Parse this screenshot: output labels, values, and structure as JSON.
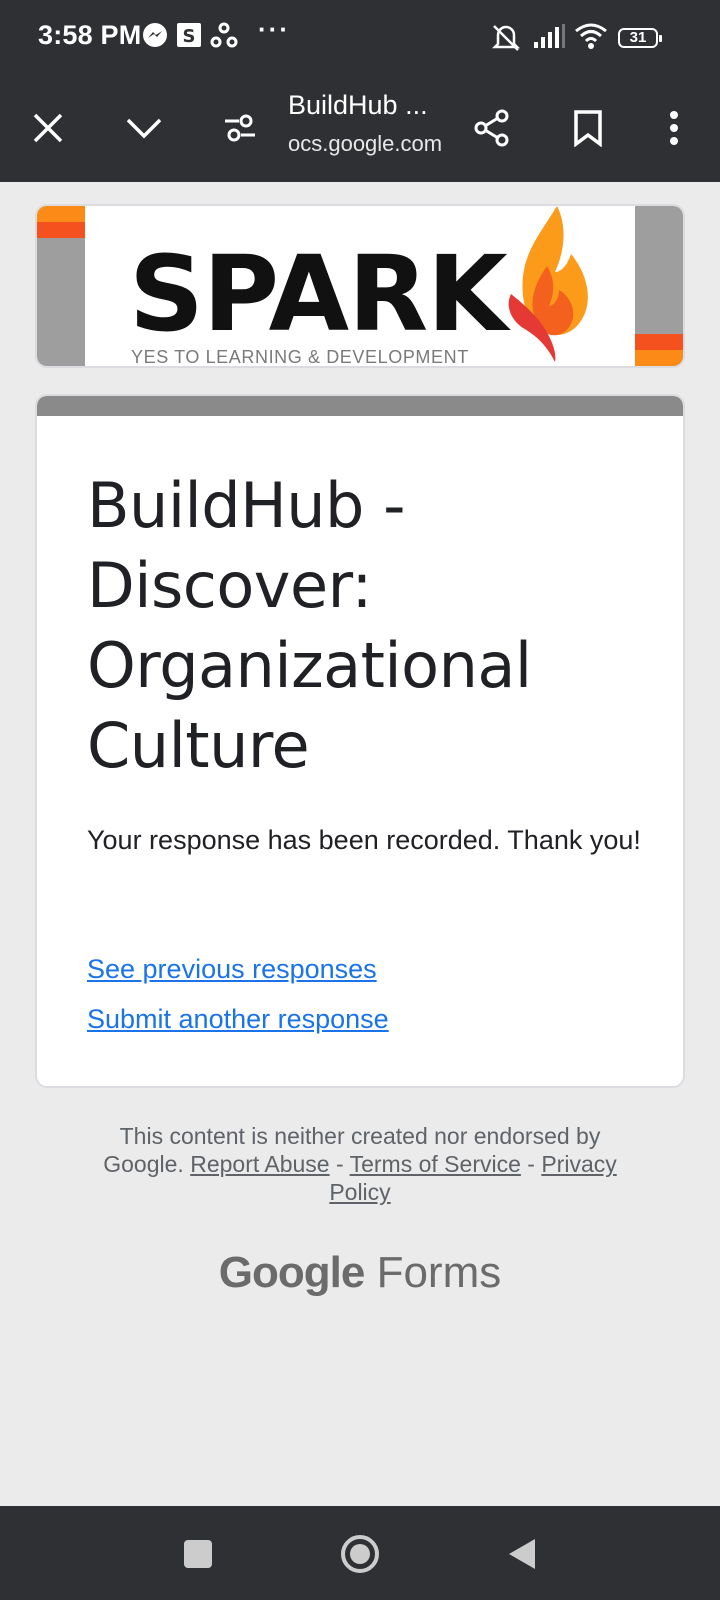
{
  "status_bar": {
    "time": "3:58 PM",
    "battery": "31",
    "icons": [
      "messenger-icon",
      "s-app-icon",
      "cycle-icon",
      "more-dots",
      "mute-icon",
      "signal-icon",
      "wifi-icon",
      "battery-icon"
    ],
    "dots": "···"
  },
  "toolbar": {
    "title": "BuildHub ...",
    "url": "ocs.google.com",
    "icons": [
      "close-icon",
      "chevron-down-icon",
      "tune-icon",
      "share-icon",
      "bookmark-icon",
      "more-vert-icon"
    ]
  },
  "banner": {
    "brand": "SPARK",
    "tagline": "YES TO LEARNING & DEVELOPMENT"
  },
  "form": {
    "title": "BuildHub -\n Discover:\nOrganizational\nCulture",
    "message": "Your response has been recorded. Thank you!",
    "link_previous": "See previous responses",
    "link_submit": "Submit another response"
  },
  "footer": {
    "disclaimer": "This content is neither created nor endorsed by Google.",
    "report_abuse": "Report Abuse",
    "separator": " - ",
    "terms": "Terms of Service",
    "privacy": "Privacy Policy",
    "logo_google": "Google",
    "logo_forms": "Forms"
  },
  "colors": {
    "bar": "#2f3033",
    "link": "#1a73e8",
    "page_bg": "#ebebeb",
    "accent_orange": "#fc8a17",
    "accent_red": "#f4511e"
  }
}
